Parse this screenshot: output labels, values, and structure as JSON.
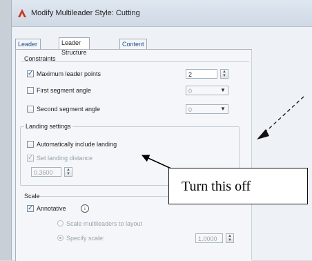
{
  "window": {
    "title": "Modify Multileader Style: Cutting",
    "icon": "autocad-app-icon"
  },
  "tabs": [
    {
      "label": "Leader Format",
      "active": false
    },
    {
      "label": "Leader Structure",
      "active": true
    },
    {
      "label": "Content",
      "active": false
    }
  ],
  "constraints": {
    "title": "Constraints",
    "max_leader_points": {
      "label": "Maximum leader points",
      "checked": true,
      "value": "2"
    },
    "first_segment_angle": {
      "label": "First segment angle",
      "checked": false,
      "value": "0"
    },
    "second_segment_angle": {
      "label": "Second segment angle",
      "checked": false,
      "value": "0"
    }
  },
  "landing": {
    "title": "Landing settings",
    "auto_include": {
      "label": "Automatically include landing",
      "checked": false
    },
    "set_distance": {
      "label": "Set landing distance",
      "checked": true,
      "disabled": true,
      "value": "0.3600"
    }
  },
  "scale": {
    "title": "Scale",
    "annotative": {
      "label": "Annotative",
      "checked": true,
      "info_icon": "info-icon"
    },
    "scale_to_layout": {
      "label": "Scale multileaders to layout",
      "selected": false
    },
    "specify_scale": {
      "label": "Specify scale:",
      "selected": true,
      "value": "1.0000"
    }
  },
  "annotation": {
    "callout_text": "Turn this off"
  },
  "colors": {
    "callout_border": "#111111",
    "checkmark": "#2e5da8"
  }
}
